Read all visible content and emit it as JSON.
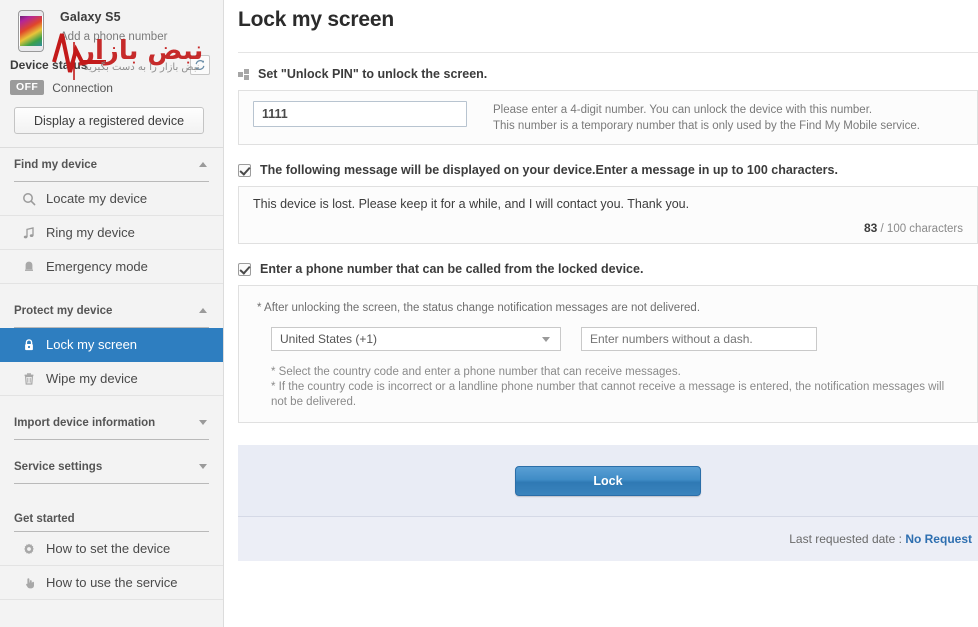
{
  "sidebar": {
    "device": {
      "name": "Galaxy S5",
      "add_phone_number": "Add a phone number",
      "status_label": "Device status",
      "refresh_icon": "refresh-icon",
      "connection_badge": "OFF",
      "connection_label": "Connection",
      "display_button": "Display a registered device",
      "thumb_icon": "phone-thumbnail-icon"
    },
    "watermark": {
      "title": "نبض بازار",
      "subtitle": "نبض بازار را به دست بگیرید",
      "icon": "pulse-line-icon",
      "color": "#c31a1a"
    },
    "groups": [
      {
        "title": "Find my device",
        "caret": "caret-up-icon",
        "expanded": true,
        "items": [
          {
            "label": "Locate my device",
            "icon": "search-icon",
            "active": false
          },
          {
            "label": "Ring my device",
            "icon": "music-note-icon",
            "active": false
          },
          {
            "label": "Emergency mode",
            "icon": "bell-icon",
            "active": false
          }
        ]
      },
      {
        "title": "Protect my device",
        "caret": "caret-up-icon",
        "expanded": true,
        "items": [
          {
            "label": "Lock my screen",
            "icon": "lock-icon",
            "active": true
          },
          {
            "label": "Wipe my device",
            "icon": "trash-icon",
            "active": false
          }
        ]
      },
      {
        "title": "Import device information",
        "caret": "caret-down-icon",
        "expanded": false,
        "items": []
      },
      {
        "title": "Service settings",
        "caret": "caret-down-icon",
        "expanded": false,
        "items": []
      }
    ],
    "get_started": {
      "title": "Get started",
      "items": [
        {
          "label": "How to set the device",
          "icon": "gear-icon"
        },
        {
          "label": "How to use the service",
          "icon": "hand-pointer-icon"
        }
      ]
    }
  },
  "main": {
    "page_title": "Lock my screen",
    "pin_section": {
      "bullet_icon": "section-bullet-icon",
      "title": "Set \"Unlock PIN\" to unlock the screen.",
      "pin_value": "1111",
      "pin_placeholder": "",
      "help_line1": "Please enter a 4-digit number. You can unlock the device with this number.",
      "help_line2": "This number is a temporary number that is only used by the Find My Mobile service."
    },
    "message_section": {
      "checkbox_checked": true,
      "label": "The following message will be displayed on your device.Enter a message in up to 100 characters.",
      "message_value": "This device is lost. Please keep it for a while, and I will contact you. Thank you.",
      "count_current": "83",
      "count_suffix": "/ 100 characters"
    },
    "phone_section": {
      "checkbox_checked": true,
      "label": "Enter a phone number that can be called from the locked device.",
      "note": "* After unlocking the screen, the status change notification messages are not delivered.",
      "country_value": "United States (+1)",
      "country_caret": "chevron-down-icon",
      "phone_placeholder": "Enter numbers without a dash.",
      "note_line1": "* Select the country code and enter a phone number that can receive messages.",
      "note_line2": "* If the country code is incorrect or a landline phone number that cannot receive a message is entered, the notification messages will not be delivered."
    },
    "action": {
      "lock_button": "Lock",
      "footer_label": "Last requested date :",
      "footer_value": "No Request",
      "accent_color": "#2e6fb0"
    }
  }
}
